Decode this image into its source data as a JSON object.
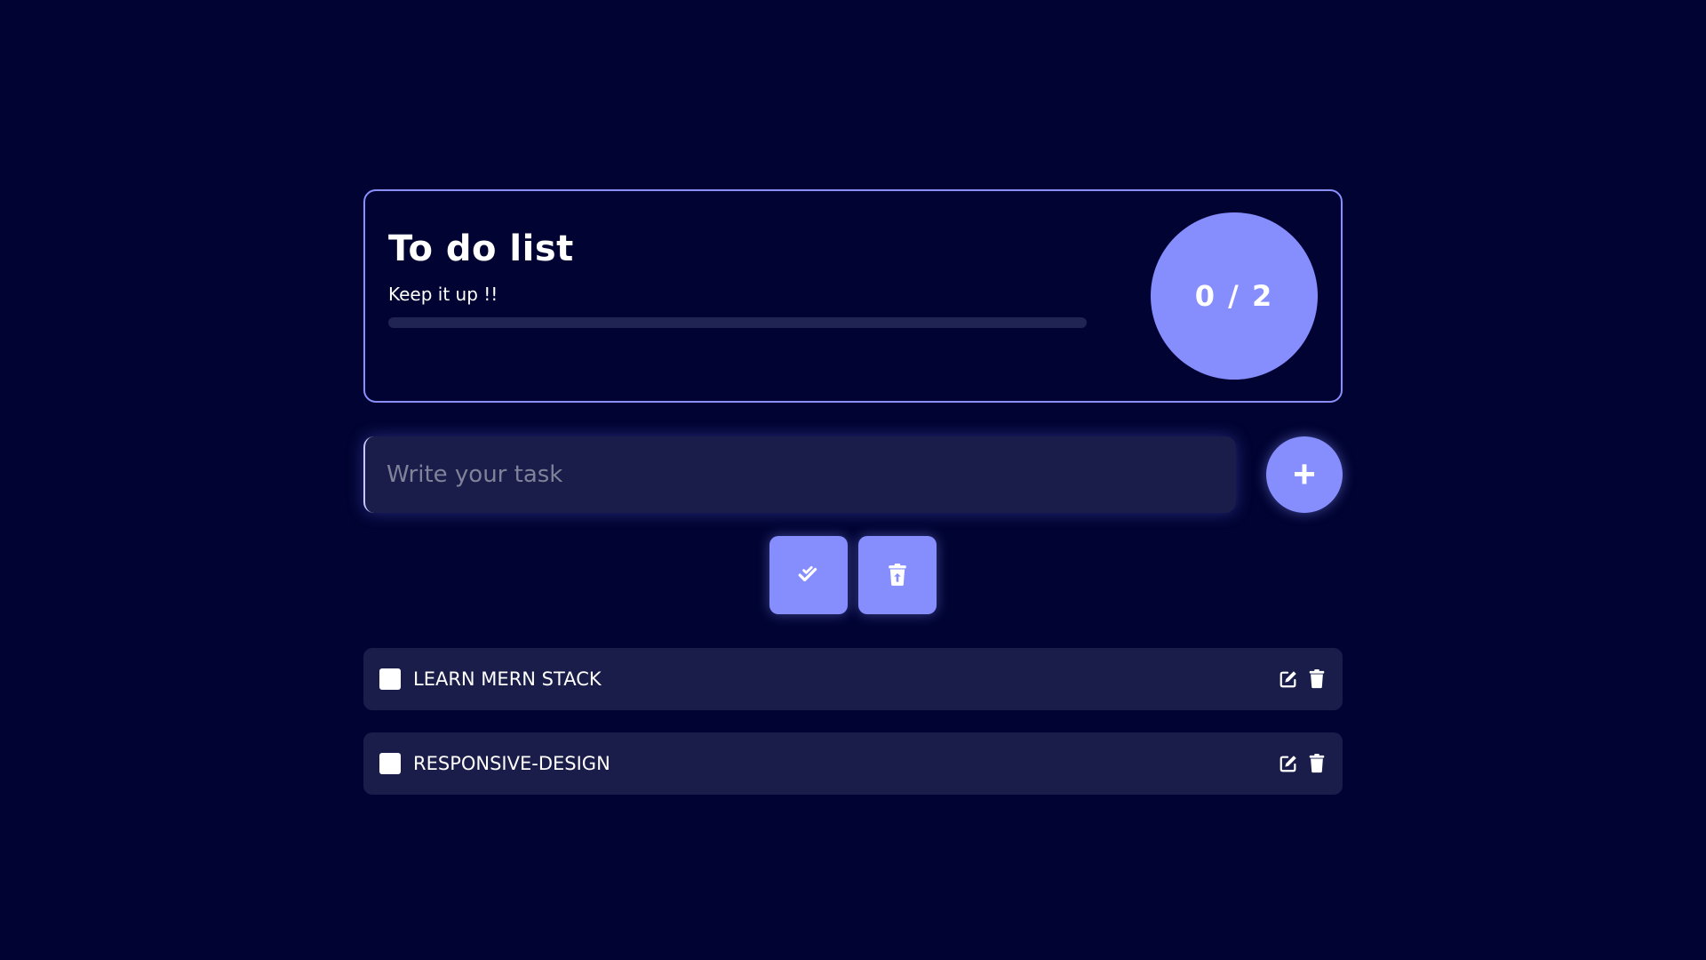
{
  "header": {
    "title": "To do list",
    "subtitle": "Keep it up !!",
    "progress": 0,
    "counter": "0 / 2"
  },
  "form": {
    "placeholder": "Write your task",
    "add_label": "+"
  },
  "icons": {
    "add": "plus-icon",
    "complete_all": "double-check-icon",
    "clear_completed": "trash-restore-icon",
    "edit": "edit-icon",
    "delete": "trash-icon"
  },
  "tasks": [
    {
      "text": "LEARN MERN STACK",
      "done": false
    },
    {
      "text": "RESPONSIVE-DESIGN",
      "done": false
    }
  ],
  "colors": {
    "background": "#010432",
    "accent": "#868dfd",
    "card": "#1a1d4a"
  }
}
